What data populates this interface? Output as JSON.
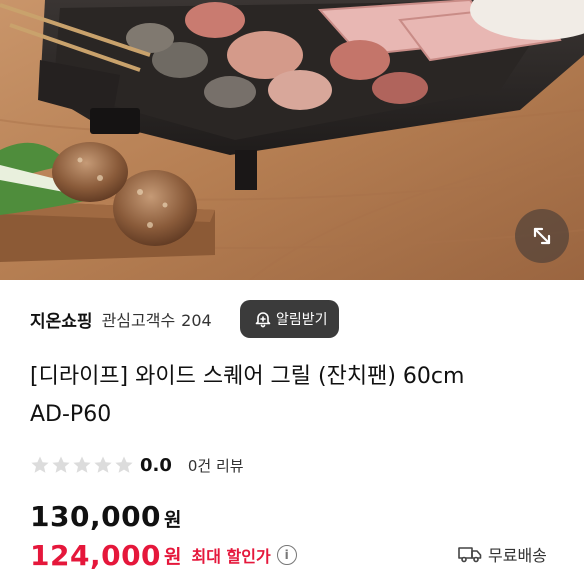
{
  "photo": {
    "alt": "product-photo",
    "expand_icon": "expand-diagonal-icon"
  },
  "store": {
    "name": "지온쇼핑",
    "followers_label": "관심고객수",
    "followers_count": "204",
    "alert_icon": "bell-plus-icon",
    "alert_label": "알림받기"
  },
  "product": {
    "title_line1": "[디라이프] 와이드 스퀘어 그릴 (잔치팬) 60cm",
    "title_line2": "AD-P60"
  },
  "rating": {
    "stars_total": 5,
    "stars_filled": 0,
    "score": "0.0",
    "reviews": "0건 리뷰"
  },
  "price": {
    "original": "130,000",
    "original_unit": "원",
    "sale": "124,000",
    "sale_unit": "원",
    "max_discount_label": "최대 할인가",
    "info_icon": "info-icon",
    "sale_color": "#e5173b"
  },
  "shipping": {
    "icon": "delivery-truck-icon",
    "label": "무료배송"
  }
}
